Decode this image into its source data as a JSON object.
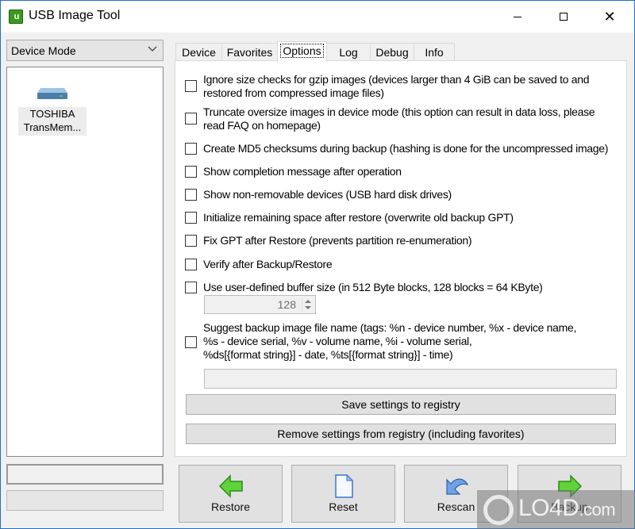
{
  "window": {
    "title": "USB Image Tool",
    "controls": {
      "minimize": "minimize",
      "maximize": "maximize",
      "close": "✕"
    }
  },
  "sidebar": {
    "mode_select": {
      "value": "Device Mode",
      "chevron": "⌵"
    },
    "devices": [
      {
        "icon": "drive-icon",
        "label_line1": "TOSHIBA",
        "label_line2": "TransMem..."
      }
    ]
  },
  "tabs": [
    {
      "label": "Device",
      "active": false
    },
    {
      "label": "Favorites",
      "active": false
    },
    {
      "label": "Options",
      "active": true
    },
    {
      "label": "Log",
      "active": false
    },
    {
      "label": "Debug",
      "active": false
    },
    {
      "label": "Info",
      "active": false
    }
  ],
  "options": {
    "items": [
      {
        "checked": false,
        "lines": [
          "Ignore size checks for gzip images (devices larger than 4 GiB can be saved to and",
          "restored from compressed image files)"
        ]
      },
      {
        "checked": false,
        "lines": [
          "Truncate oversize images in device mode (this option can result in data loss, please",
          "read FAQ on homepage)"
        ]
      },
      {
        "checked": false,
        "lines": [
          "Create MD5 checksums during backup (hashing is done for the uncompressed image)"
        ]
      },
      {
        "checked": false,
        "lines": [
          "Show completion message after operation"
        ]
      },
      {
        "checked": false,
        "lines": [
          "Show non-removable devices (USB hard disk drives)"
        ]
      },
      {
        "checked": false,
        "lines": [
          "Initialize remaining space after restore (overwrite old backup GPT)"
        ]
      },
      {
        "checked": false,
        "lines": [
          "Fix GPT after Restore (prevents partition re-enumeration)"
        ]
      },
      {
        "checked": false,
        "lines": [
          "Verify after Backup/Restore"
        ]
      },
      {
        "checked": false,
        "lines": [
          "Use user-defined buffer size (in 512 Byte blocks, 128 blocks = 64 KByte)"
        ]
      },
      {
        "checked": false,
        "lines": [
          "Suggest backup image file name (tags: %n - device number, %x - device name,",
          "%s - device serial, %v - volume name, %i - volume serial,",
          "%ds[{format string}] - date, %ts[{format string}] - time)"
        ]
      }
    ],
    "buffer_size_value": "128",
    "file_name_value": "",
    "save_button": "Save settings to registry",
    "remove_button": "Remove settings from registry (including favorites)"
  },
  "actions": {
    "restore": "Restore",
    "reset": "Reset",
    "rescan": "Rescan",
    "backup": "Backup"
  },
  "watermark": {
    "text": "LO4D",
    "suffix": ".com"
  }
}
